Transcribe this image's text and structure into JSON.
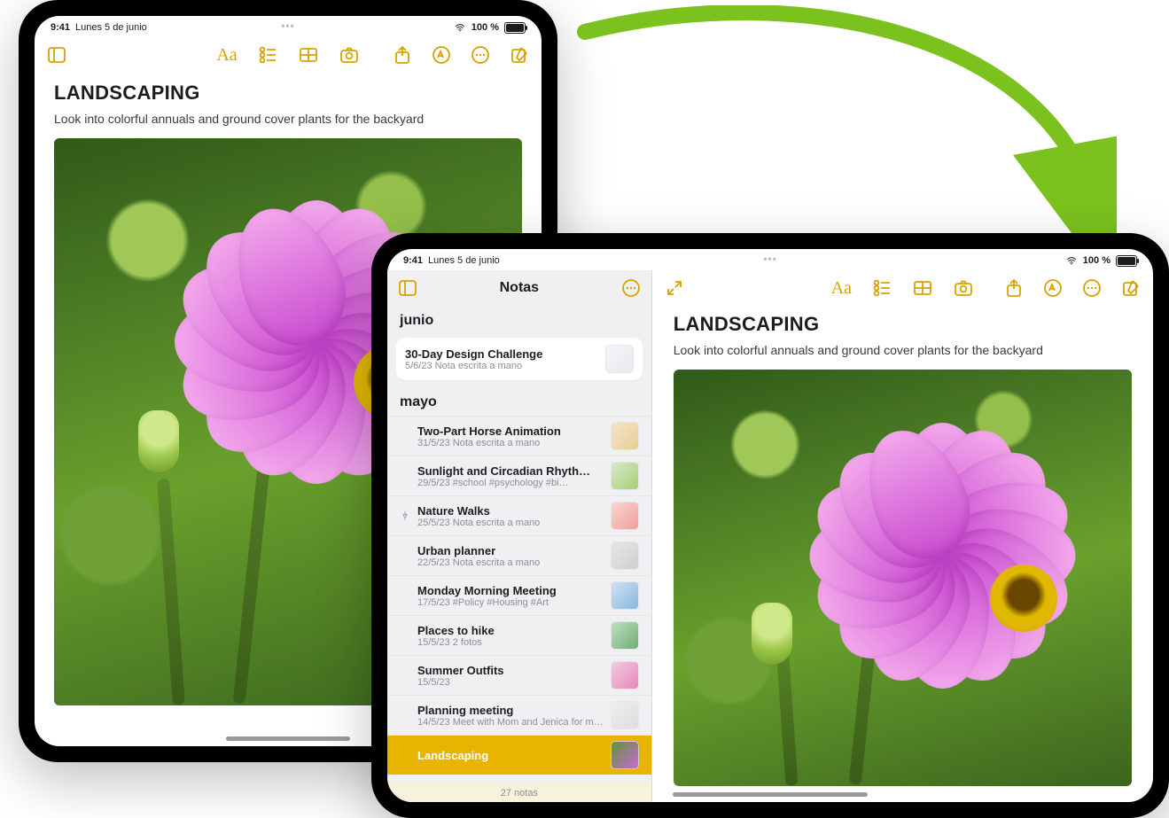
{
  "status": {
    "time": "9:41",
    "date": "Lunes 5 de junio",
    "battery_pct": "100 %",
    "wifi_icon": "wifi",
    "center_dots": "•••"
  },
  "toolbar": {
    "sidebar_toggle": "sidebar",
    "format": "Aa",
    "checklist": "checklist",
    "table": "table",
    "camera": "camera",
    "share": "share",
    "markup": "markup",
    "more": "more",
    "compose": "compose",
    "expand": "expand"
  },
  "note": {
    "title": "LANDSCAPING",
    "body": "Look into colorful annuals and ground cover plants for the backyard"
  },
  "sidebar": {
    "title": "Notas",
    "groups": [
      {
        "month": "junio",
        "items": [
          {
            "title": "30-Day Design Challenge",
            "date": "5/6/23",
            "sub": "Nota escrita a mano",
            "pinned": false,
            "selected": false
          }
        ]
      },
      {
        "month": "mayo",
        "items": [
          {
            "title": "Two-Part Horse Animation",
            "date": "31/5/23",
            "sub": "Nota escrita a mano",
            "pinned": false,
            "selected": false
          },
          {
            "title": "Sunlight and Circadian Rhyth…",
            "date": "29/5/23",
            "sub": "#school #psychology #bi…",
            "pinned": false,
            "selected": false
          },
          {
            "title": "Nature Walks",
            "date": "25/5/23",
            "sub": "Nota escrita a mano",
            "pinned": true,
            "selected": false
          },
          {
            "title": "Urban planner",
            "date": "22/5/23",
            "sub": "Nota escrita a mano",
            "pinned": false,
            "selected": false
          },
          {
            "title": "Monday Morning Meeting",
            "date": "17/5/23",
            "sub": "#Policy #Housing #Art",
            "pinned": false,
            "selected": false
          },
          {
            "title": "Places to hike",
            "date": "15/5/23",
            "sub": "2 fotos",
            "pinned": false,
            "selected": false
          },
          {
            "title": "Summer Outfits",
            "date": "15/5/23",
            "sub": "",
            "pinned": false,
            "selected": false
          },
          {
            "title": "Planning meeting",
            "date": "14/5/23",
            "sub": "Meet with Mom and Jenica for m…",
            "pinned": false,
            "selected": false
          },
          {
            "title": "Landscaping",
            "date": "",
            "sub": "",
            "pinned": false,
            "selected": true
          }
        ]
      }
    ],
    "footer_count": "27 notas"
  },
  "thumb_colors": [
    "linear-gradient(135deg,#f6f6f8,#e9e9ee)",
    "linear-gradient(135deg,#f2e4c6,#e7cf95)",
    "linear-gradient(135deg,#d9e9c9,#a7cf74)",
    "linear-gradient(135deg,#f9d4d0,#eea29a)",
    "linear-gradient(135deg,#e6e6e6,#cfcfcf)",
    "linear-gradient(135deg,#cfe2f3,#88b6e0)",
    "linear-gradient(135deg,#bfe0c2,#6fae74)",
    "linear-gradient(135deg,#f6c9e0,#e28ab8)",
    "linear-gradient(135deg,#eeeeee,#dddddd)",
    "linear-gradient(135deg,#62923a,#c56bd0)"
  ]
}
